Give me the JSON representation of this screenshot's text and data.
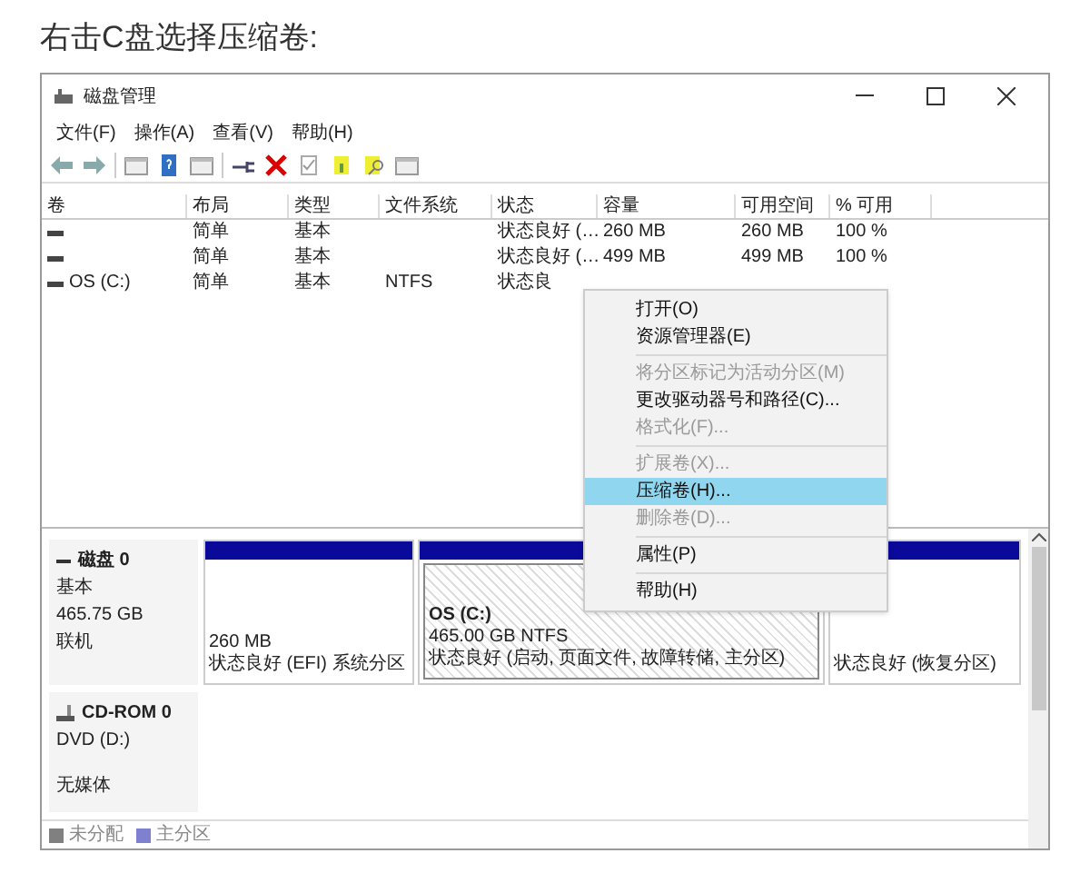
{
  "heading": "右击C盘选择压缩卷:",
  "window": {
    "title": "磁盘管理"
  },
  "menu_bar": [
    "文件(F)",
    "操作(A)",
    "查看(V)",
    "帮助(H)"
  ],
  "table": {
    "columns": [
      "卷",
      "布局",
      "类型",
      "文件系统",
      "状态",
      "容量",
      "可用空间",
      "% 可用"
    ],
    "rows": [
      {
        "cells": [
          "",
          "简单",
          "基本",
          "",
          "状态良好 (…",
          "260 MB",
          "260 MB",
          "100 %"
        ]
      },
      {
        "cells": [
          "",
          "简单",
          "基本",
          "",
          "状态良好 (…",
          "499 MB",
          "499 MB",
          "100 %"
        ]
      },
      {
        "cells": [
          "OS (C:)",
          "简单",
          "基本",
          "NTFS",
          "状态良"
        ]
      }
    ]
  },
  "context_menu": {
    "items": [
      {
        "kind": "item",
        "label": "打开(O)",
        "disabled": false,
        "selected": false
      },
      {
        "kind": "item",
        "label": "资源管理器(E)",
        "disabled": false,
        "selected": false
      },
      {
        "kind": "separator"
      },
      {
        "kind": "item",
        "label": "将分区标记为活动分区(M)",
        "disabled": true,
        "selected": false
      },
      {
        "kind": "item",
        "label": "更改驱动器号和路径(C)...",
        "disabled": false,
        "selected": false
      },
      {
        "kind": "item",
        "label": "格式化(F)...",
        "disabled": true,
        "selected": false
      },
      {
        "kind": "separator"
      },
      {
        "kind": "item",
        "label": "扩展卷(X)...",
        "disabled": true,
        "selected": false
      },
      {
        "kind": "item",
        "label": "压缩卷(H)...",
        "disabled": false,
        "selected": true
      },
      {
        "kind": "item",
        "label": "删除卷(D)...",
        "disabled": true,
        "selected": false
      },
      {
        "kind": "separator"
      },
      {
        "kind": "item",
        "label": "属性(P)",
        "disabled": false,
        "selected": false
      },
      {
        "kind": "separator"
      },
      {
        "kind": "item",
        "label": "帮助(H)",
        "disabled": false,
        "selected": false
      }
    ]
  },
  "disks": [
    {
      "kind": "disk",
      "name": "磁盘 0",
      "type": "基本",
      "size": "465.75 GB",
      "state": "联机",
      "partitions": [
        {
          "size": "260 MB",
          "status": "状态良好 (EFI) 系统分区",
          "selected": false
        },
        {
          "name": "OS (C:)",
          "size": "465.00 GB NTFS",
          "status": "状态良好 (启动, 页面文件, 故障转储, 主分区)",
          "selected": true
        },
        {
          "status": "状态良好 (恢复分区)",
          "selected": false
        }
      ]
    },
    {
      "kind": "cdrom",
      "name": "CD-ROM 0",
      "type": "DVD (D:)",
      "state": "无媒体"
    }
  ],
  "legend": [
    {
      "label": "未分配",
      "color": "#808080"
    },
    {
      "label": "主分区",
      "color": "#8080d0"
    }
  ]
}
